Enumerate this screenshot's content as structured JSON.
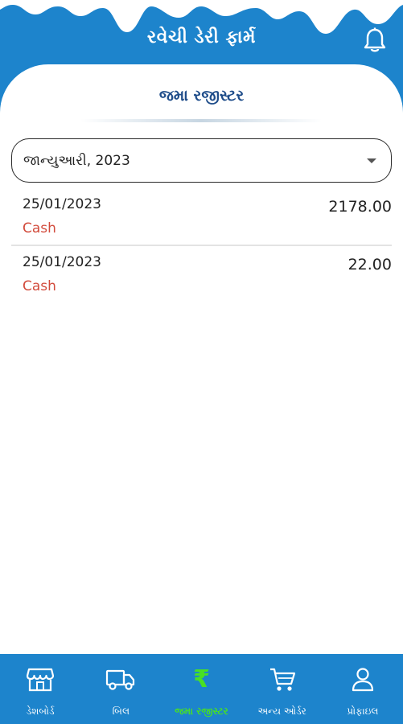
{
  "header": {
    "app_title": "રવેચી ડેરી ફાર્મ",
    "notification_icon": "bell-icon"
  },
  "page": {
    "title": "જમા રજીસ્ટર"
  },
  "month_filter": {
    "selected": "જાન્યુઆરી, 2023",
    "icon": "chevron-down-icon"
  },
  "entries": [
    {
      "date": "25/01/2023",
      "mode": "Cash",
      "amount": "2178.00"
    },
    {
      "date": "25/01/2023",
      "mode": "Cash",
      "amount": "22.00"
    }
  ],
  "bottom_nav": {
    "items": [
      {
        "label": "ડેશબોર્ડ",
        "icon": "store-icon",
        "active": false
      },
      {
        "label": "બિલ",
        "icon": "truck-icon",
        "active": false
      },
      {
        "label": "જમા રજીસ્ટર",
        "icon": "rupee-icon",
        "active": true
      },
      {
        "label": "અન્ય ઓર્ડર",
        "icon": "cart-icon",
        "active": false
      },
      {
        "label": "પ્રોફાઇલ",
        "icon": "profile-icon",
        "active": false
      }
    ]
  },
  "colors": {
    "primary": "#1d84cc",
    "active_nav": "#48e024",
    "title": "#1f4d8a",
    "payment_mode": "#d24b3c"
  }
}
